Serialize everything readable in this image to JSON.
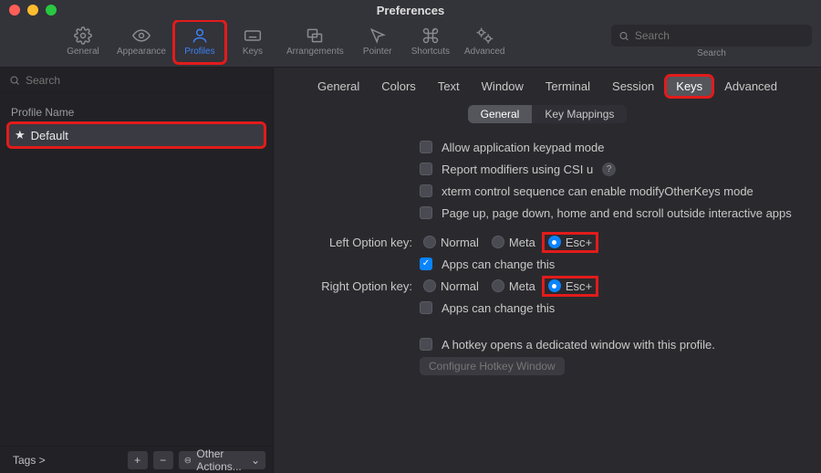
{
  "window": {
    "title": "Preferences"
  },
  "toolbar": {
    "items": [
      {
        "id": "general",
        "label": "General"
      },
      {
        "id": "appearance",
        "label": "Appearance"
      },
      {
        "id": "profiles",
        "label": "Profiles"
      },
      {
        "id": "keys",
        "label": "Keys"
      },
      {
        "id": "arrangements",
        "label": "Arrangements"
      },
      {
        "id": "pointer",
        "label": "Pointer"
      },
      {
        "id": "shortcuts",
        "label": "Shortcuts"
      },
      {
        "id": "advanced",
        "label": "Advanced"
      }
    ],
    "search_placeholder": "Search",
    "search_label": "Search"
  },
  "sidebar": {
    "search_placeholder": "Search",
    "header": "Profile Name",
    "profiles": [
      {
        "name": "Default",
        "starred": true
      }
    ],
    "tags_label": "Tags >",
    "other_actions_label": "Other Actions..."
  },
  "tabs": {
    "items": [
      "General",
      "Colors",
      "Text",
      "Window",
      "Terminal",
      "Session",
      "Keys",
      "Advanced"
    ],
    "selected": "Keys"
  },
  "subtabs": {
    "items": [
      "General",
      "Key Mappings"
    ],
    "selected": "General"
  },
  "form": {
    "allow_keypad": {
      "label": "Allow application keypad mode",
      "checked": false
    },
    "csi_u": {
      "label": "Report modifiers using CSI u",
      "checked": false
    },
    "xterm": {
      "label": "xterm control sequence can enable modifyOtherKeys mode",
      "checked": false
    },
    "pageup": {
      "label": "Page up, page down, home and end scroll outside interactive apps",
      "checked": false
    },
    "left_option": {
      "label": "Left Option key:",
      "options": [
        "Normal",
        "Meta",
        "Esc+"
      ],
      "selected": "Esc+",
      "apps_can_change": {
        "label": "Apps can change this",
        "checked": true
      }
    },
    "right_option": {
      "label": "Right Option key:",
      "options": [
        "Normal",
        "Meta",
        "Esc+"
      ],
      "selected": "Esc+",
      "apps_can_change": {
        "label": "Apps can change this",
        "checked": false
      }
    },
    "hotkey": {
      "label": "A hotkey opens a dedicated window with this profile.",
      "checked": false
    },
    "configure_hotkey_button": "Configure Hotkey Window"
  }
}
